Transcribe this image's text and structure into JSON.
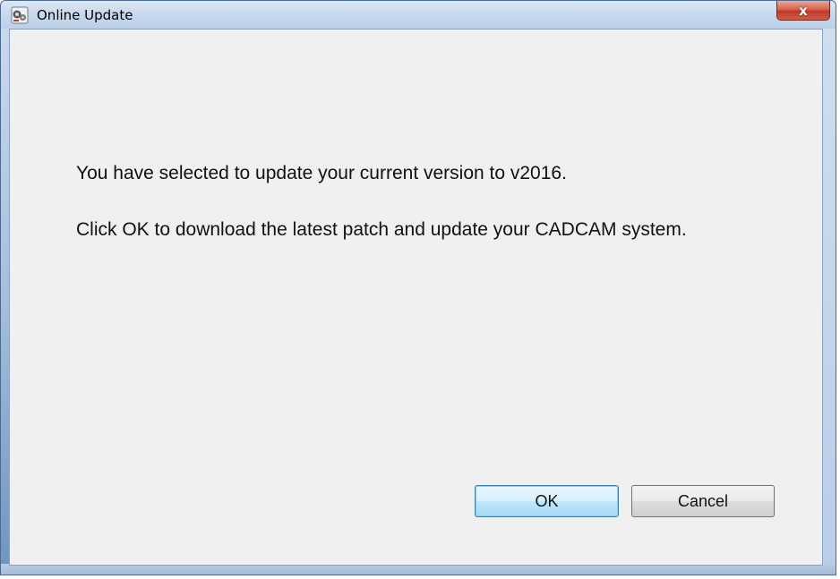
{
  "window": {
    "title": "Online Update",
    "icon": "online-update-app-icon",
    "close_label": "x"
  },
  "message": {
    "line1": "You have selected to update your current version to v2016.",
    "line2": "Click OK to download the latest patch and update your CADCAM system."
  },
  "buttons": {
    "ok_label": "OK",
    "cancel_label": "Cancel"
  },
  "colors": {
    "close_button": "#c0392b",
    "client_background": "#f0f0f0",
    "default_button_border": "#3c7fb1"
  }
}
